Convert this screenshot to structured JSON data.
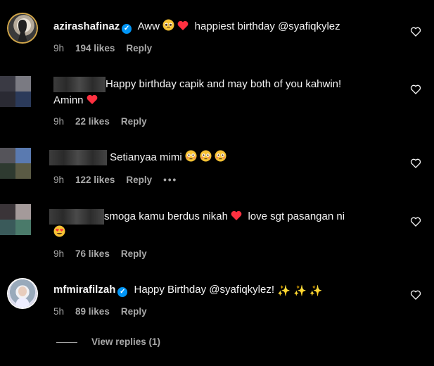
{
  "comments": [
    {
      "username": "azirashafinaz",
      "verified": true,
      "text_pre": "Aww",
      "text_post": "happiest birthday @syafiqkylez",
      "time": "9h",
      "likes": "194 likes",
      "reply": "Reply"
    },
    {
      "username": "",
      "text": "Happy birthday capik and may both of you kahwin!",
      "text2": "Aminn",
      "time": "9h",
      "likes": "22 likes",
      "reply": "Reply"
    },
    {
      "username": "",
      "text": "Setianyaa mimi",
      "time": "9h",
      "likes": "122 likes",
      "reply": "Reply",
      "more": "•••"
    },
    {
      "username": "",
      "text_pre": "smoga kamu berdus nikah",
      "text_post": "love sgt pasangan ni",
      "time": "9h",
      "likes": "76 likes",
      "reply": "Reply"
    },
    {
      "username": "mfmirafilzah",
      "verified": true,
      "text": "Happy Birthday @syafiqkylez!",
      "time": "5h",
      "likes": "89 likes",
      "reply": "Reply"
    }
  ],
  "view_replies": "View replies (1)",
  "colors": {
    "background": "#000000",
    "text": "#f5f5f5",
    "muted": "#a8a8a8",
    "verified": "#0095f6",
    "heart": "#ff3040"
  }
}
